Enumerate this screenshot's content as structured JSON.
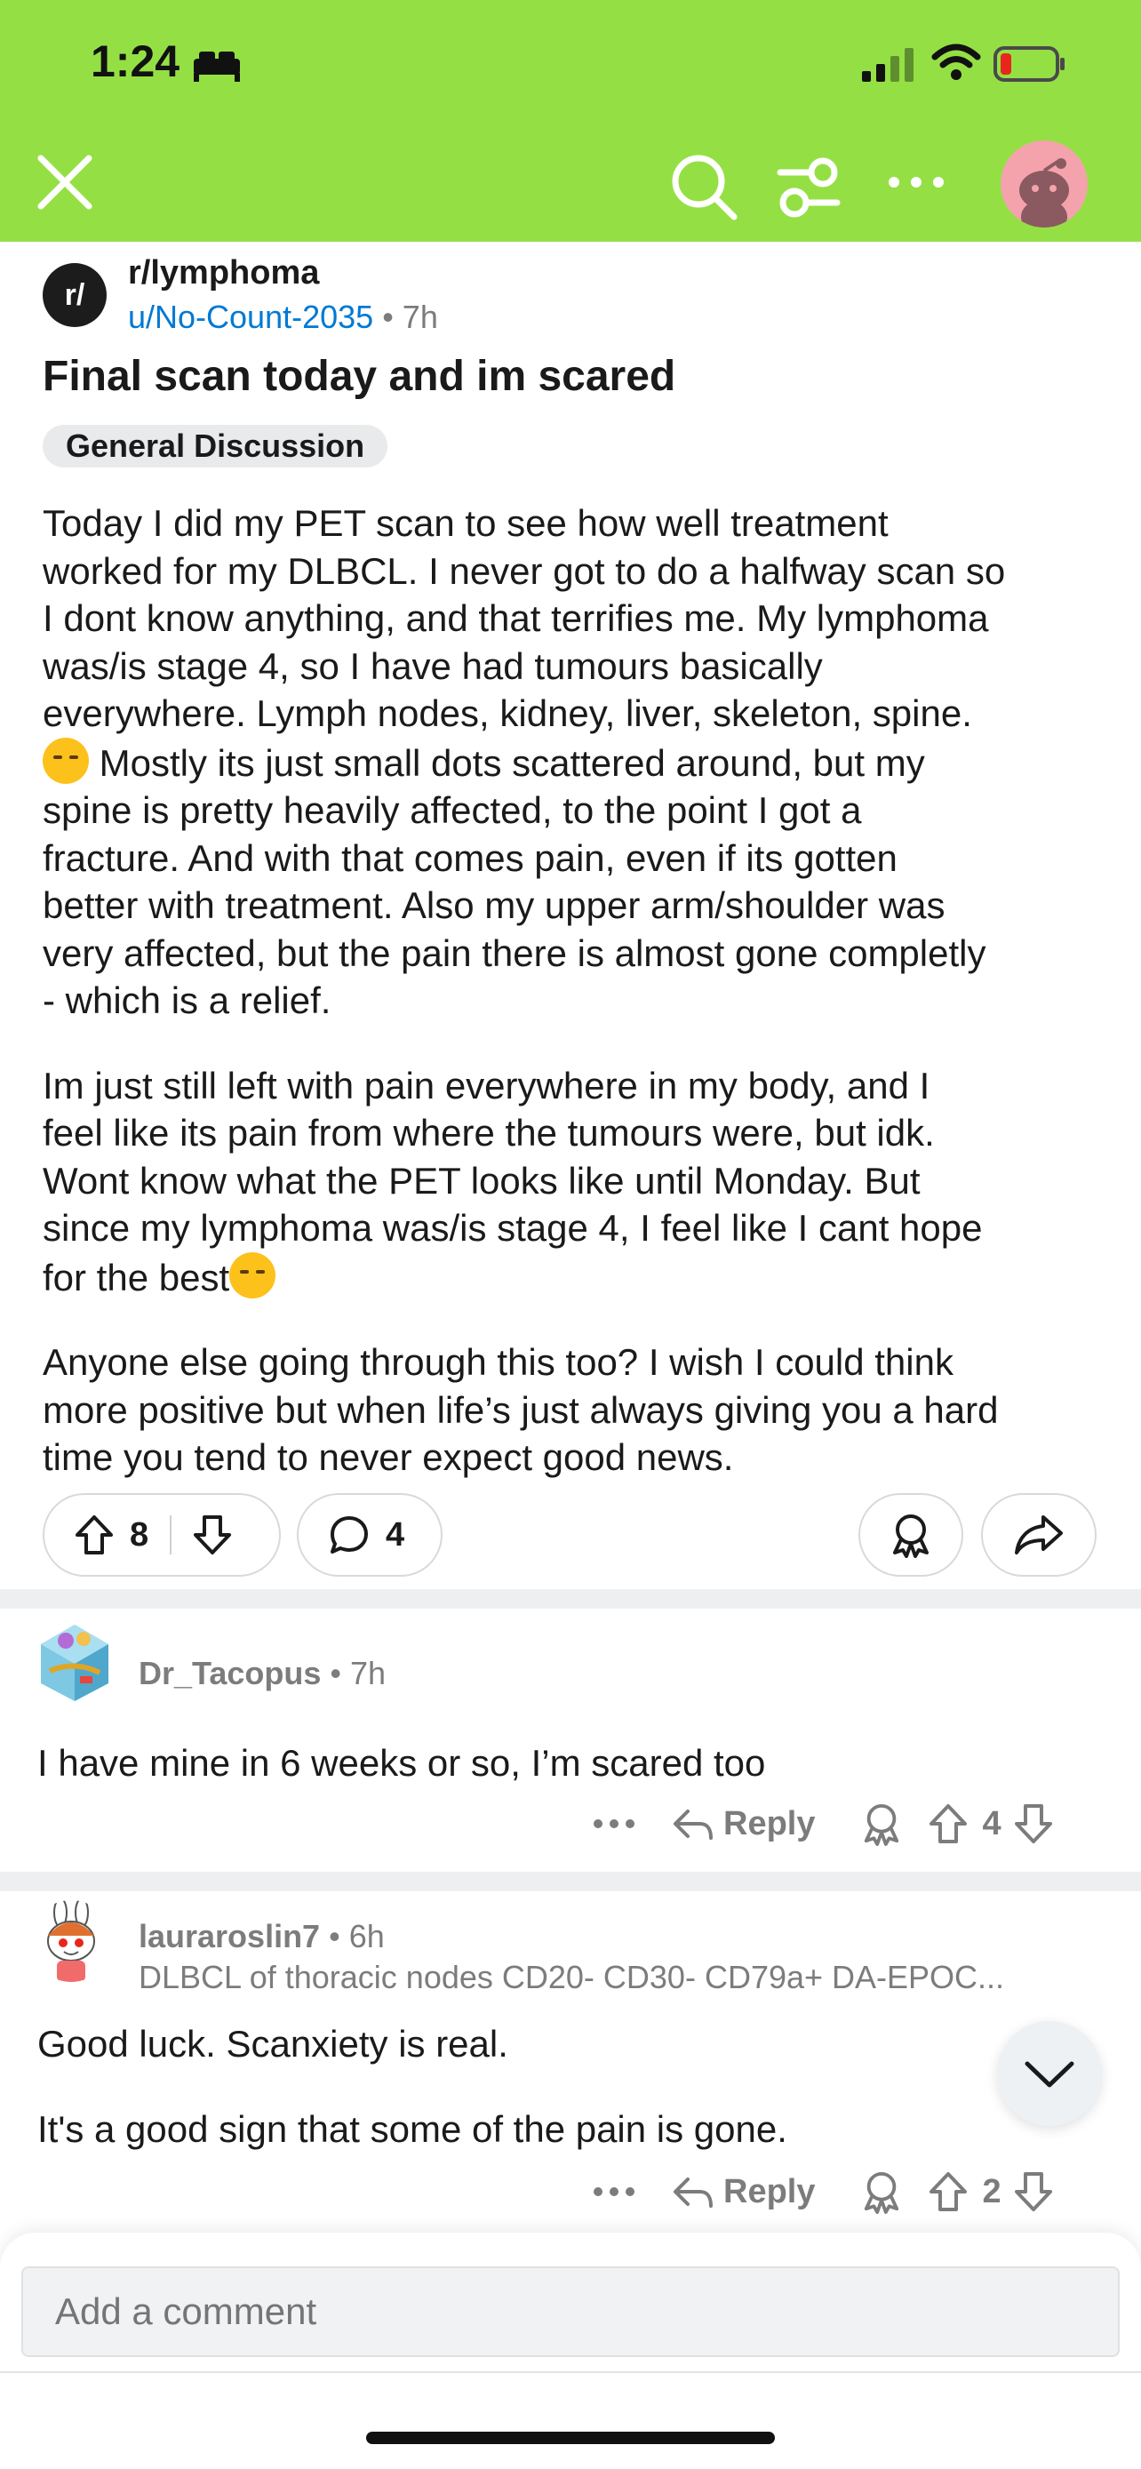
{
  "status_bar": {
    "time": "1:24"
  },
  "post": {
    "subreddit": "r/lymphoma",
    "subreddit_icon_text": "r/",
    "author": "u/No-Count-2035",
    "age": "7h",
    "title": "Final scan today and im scared",
    "flair": "General Discussion",
    "body": {
      "p1_a": "Today I did my PET scan to see how well treatment\nworked for my DLBCL. I never got to do a halfway scan so\nI dont know anything, and that terrifies me. My lymphoma\nwas/is stage 4, so I have had tumours basically\neverywhere. Lymph nodes, kidney, liver, skeleton, spine.\n",
      "p1_b": " Mostly its just small dots scattered around, but my\nspine is pretty heavily affected, to the point I got a\nfracture. And with that comes pain, even if its gotten\nbetter with treatment. Also my upper arm/shoulder was\nvery affected, but the pain there is almost gone completly\n- which is a relief.",
      "p2": "Im just still left with pain everywhere in my body, and I\nfeel like its pain from where the tumours were, but idk.\nWont know what the PET looks like until Monday. But\nsince my lymphoma was/is stage 4, I feel like I cant hope\nfor the best",
      "p3": "Anyone else going through this too? I wish I could think\nmore positive but when life’s just always giving you a hard\ntime you tend to never expect good news."
    },
    "votes": "8",
    "comments": "4"
  },
  "comments": [
    {
      "username": "Dr_Tacopus",
      "age": "7h",
      "flair": "",
      "body": "I have mine in 6 weeks or so, I’m scared too",
      "reply_label": "Reply",
      "votes": "4"
    },
    {
      "username": "lauraroslin7",
      "age": "6h",
      "flair": "DLBCL of thoracic nodes CD20- CD30-  CD79a+ DA-EPOC...",
      "body_1": "Good luck. Scanxiety is real.",
      "body_2": "It's a good sign that some of the pain is gone.",
      "reply_label": "Reply",
      "votes": "2"
    }
  ],
  "comment_input": {
    "placeholder": "Add a comment"
  },
  "colors": {
    "header_bg": "#94e044",
    "author_link": "#0079d3",
    "muted": "#7c7c7c"
  },
  "icons": [
    "close-icon",
    "search-icon",
    "filter-icon",
    "more-icon",
    "avatar",
    "upvote-icon",
    "downvote-icon",
    "comment-icon",
    "award-icon",
    "share-icon",
    "reply-icon",
    "chevron-down-icon"
  ]
}
